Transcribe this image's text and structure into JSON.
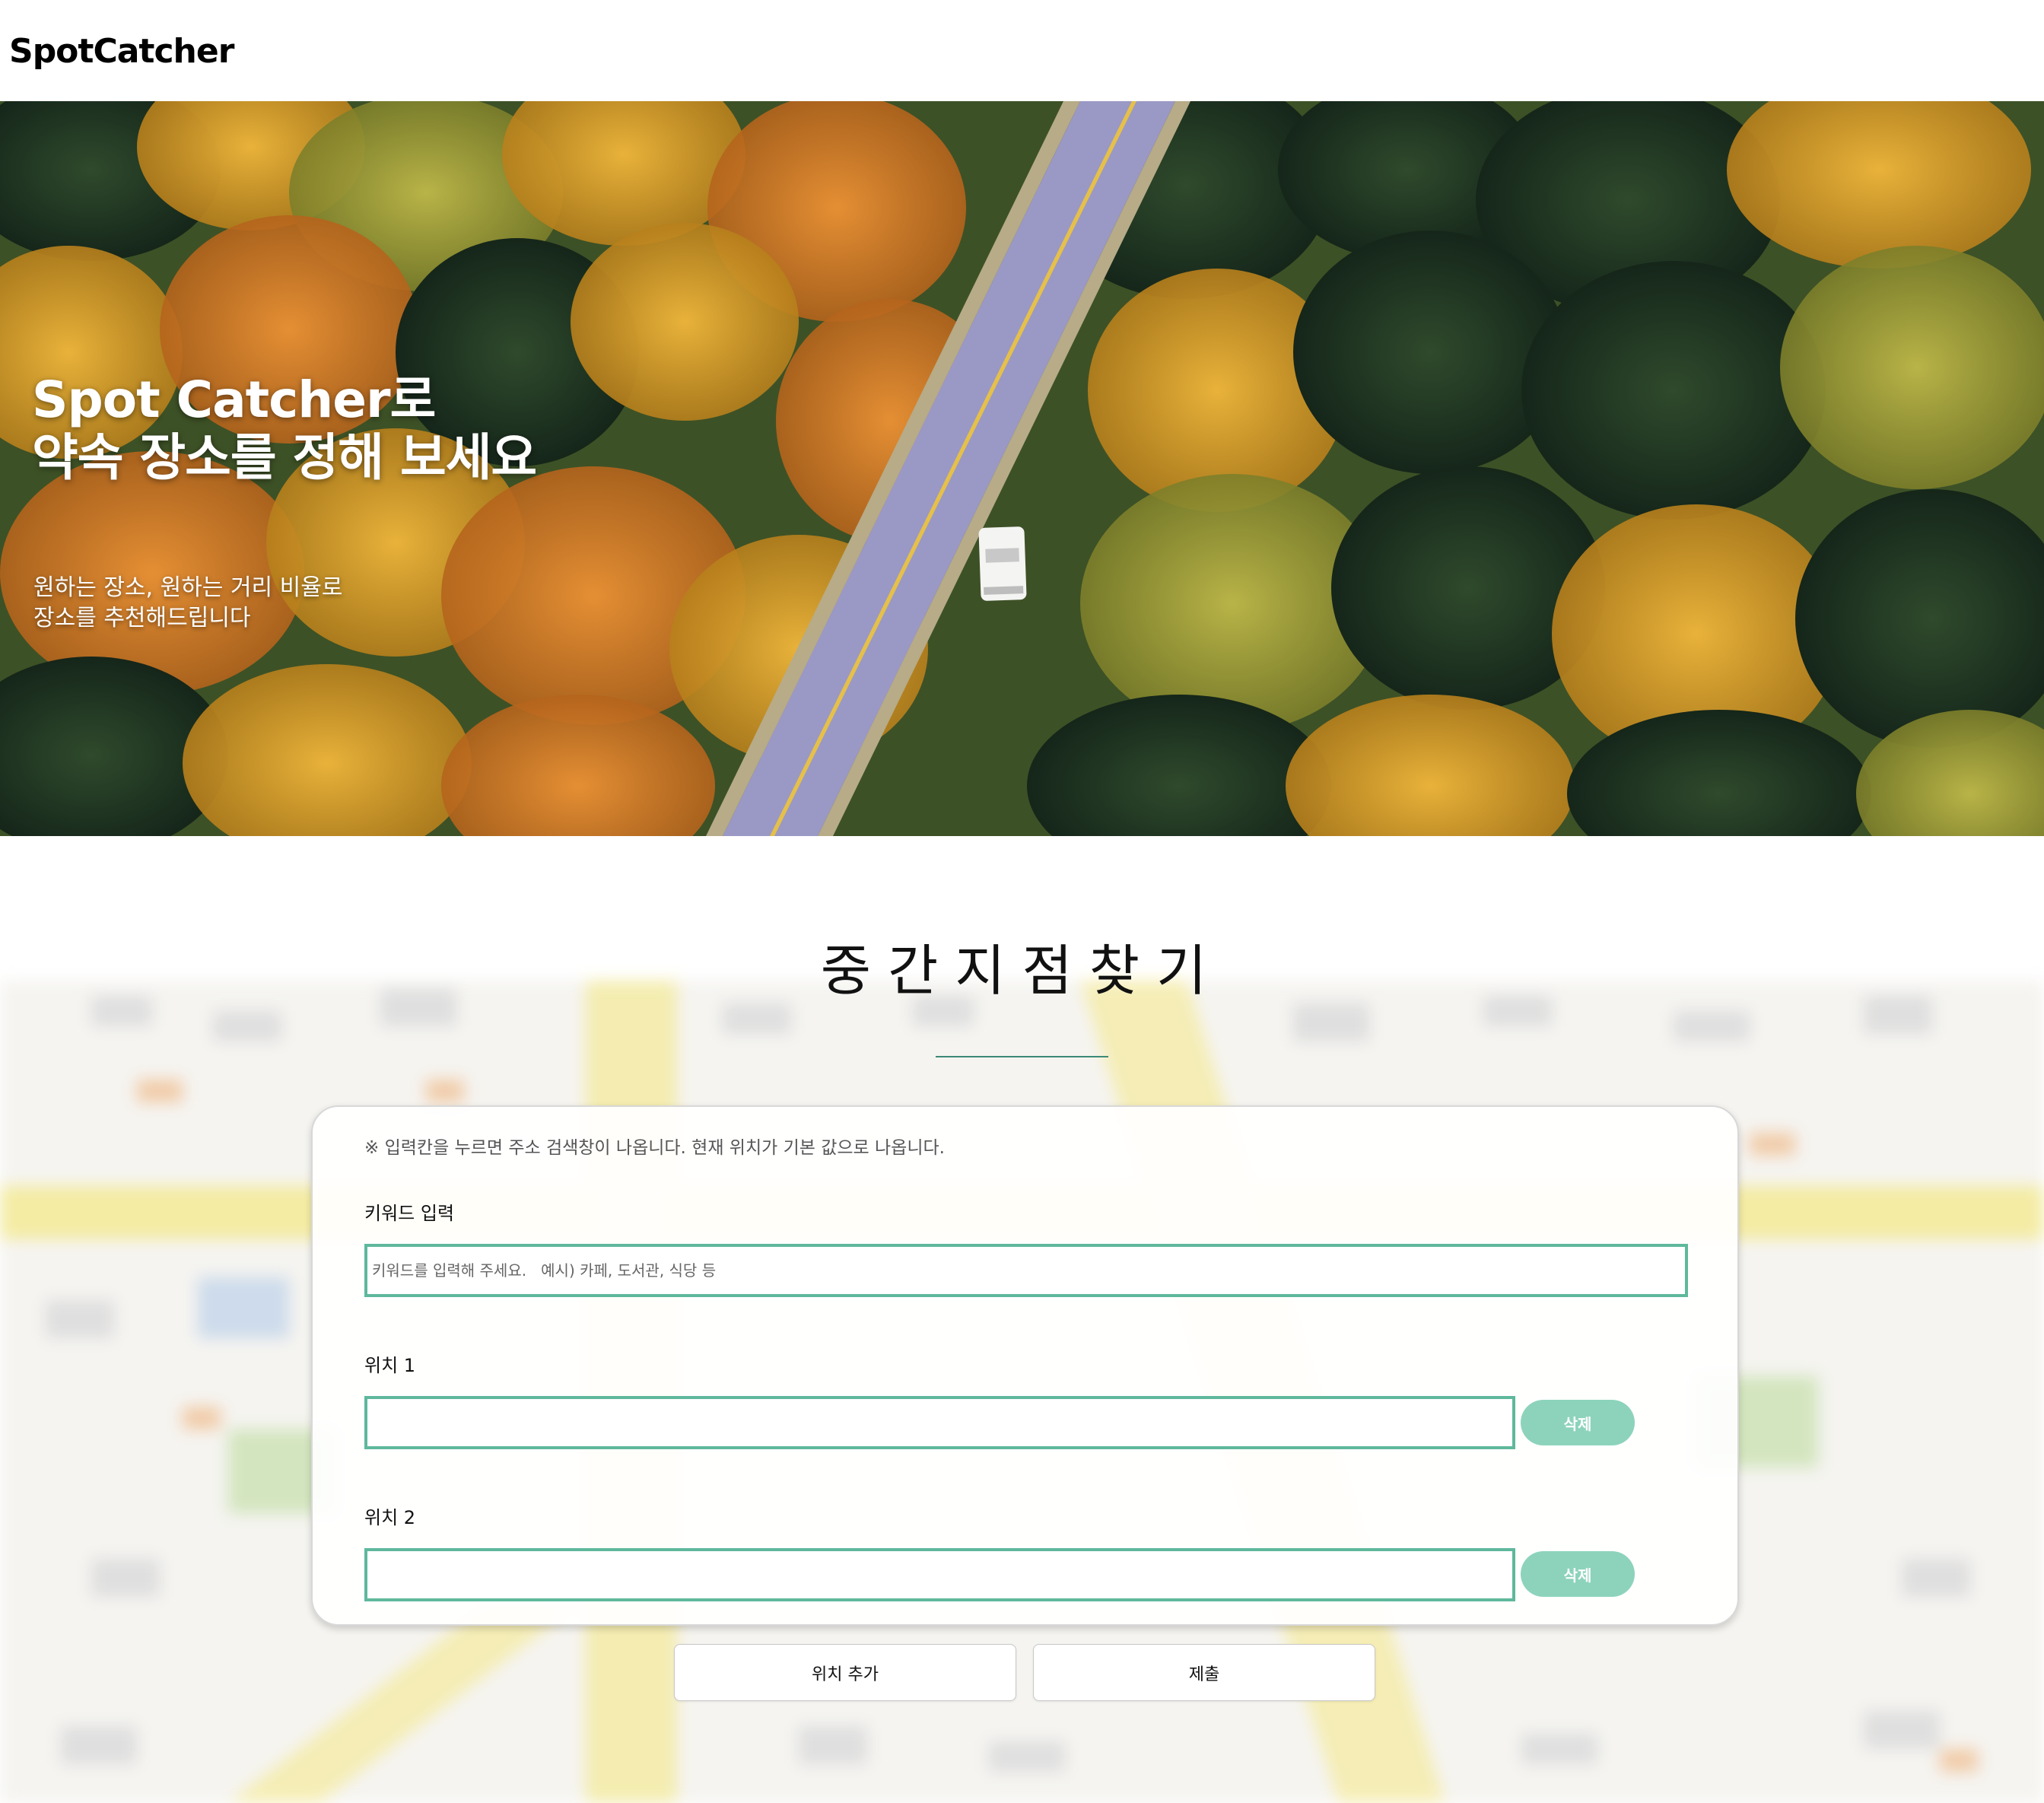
{
  "header": {
    "logo": "SpotCatcher"
  },
  "hero": {
    "title_line1": "Spot Catcher로",
    "title_line2": "약속 장소를 정해 보세요",
    "subtitle_line1": "원하는 장소, 원하는 거리 비율로",
    "subtitle_line2": "장소를 추천해드립니다"
  },
  "main": {
    "title": "중간지점찾기",
    "notice": "※ 입력칸을 누르면 주소 검색창이 나옵니다. 현재 위치가 기본 값으로 나옵니다.",
    "keyword": {
      "label": "키워드 입력",
      "placeholder": "키워드를 입력해 주세요.   예시) 카페, 도서관, 식당 등",
      "value": ""
    },
    "locations": [
      {
        "label": "위치 1",
        "value": "",
        "delete_label": "삭제"
      },
      {
        "label": "위치 2",
        "value": "",
        "delete_label": "삭제"
      }
    ],
    "add_location_label": "위치 추가",
    "submit_label": "제출"
  },
  "colors": {
    "accent": "#5fb89c",
    "delete_button": "#8dd3bc",
    "title_underline": "#3c8a78"
  }
}
